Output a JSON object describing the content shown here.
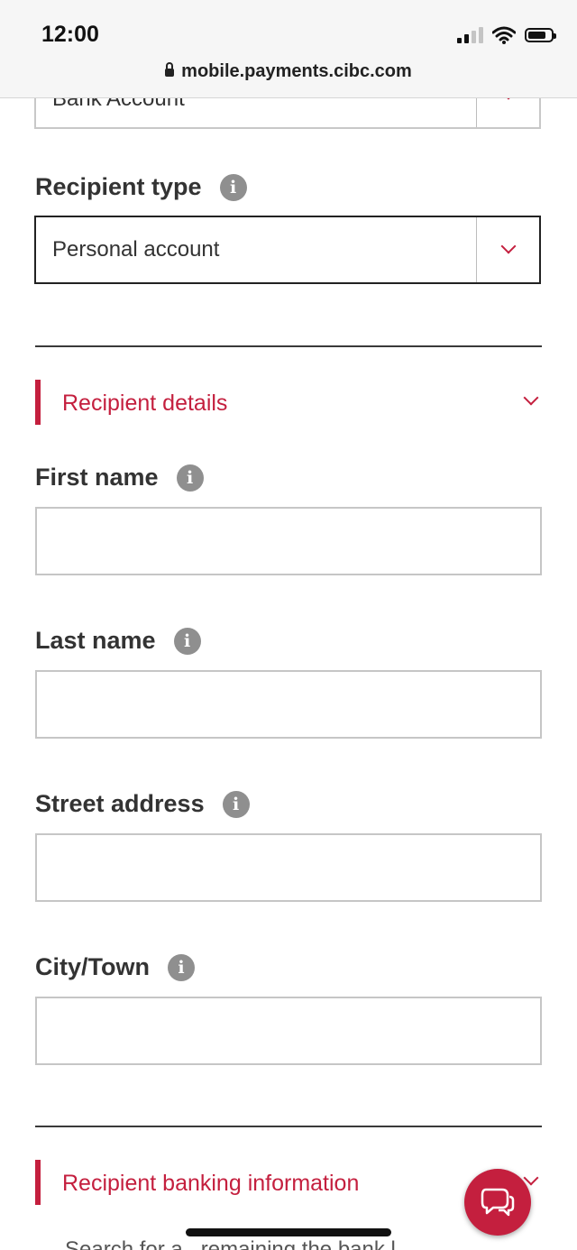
{
  "status_bar": {
    "time": "12:00"
  },
  "browser": {
    "url": "mobile.payments.cibc.com"
  },
  "form": {
    "prev_select": {
      "value": "Bank Account"
    },
    "recipient_type": {
      "label": "Recipient type",
      "value": "Personal account"
    },
    "sections": {
      "recipient_details": "Recipient details",
      "recipient_banking": "Recipient banking information"
    },
    "fields": {
      "first_name": {
        "label": "First name",
        "value": ""
      },
      "last_name": {
        "label": "Last name",
        "value": ""
      },
      "street_address": {
        "label": "Street address",
        "value": ""
      },
      "city_town": {
        "label": "City/Town",
        "value": ""
      }
    },
    "partial_bottom_text": "Search for a...remaining the bank l..."
  },
  "colors": {
    "accent": "#c41f3e",
    "info_icon": "#8f8f8f"
  },
  "icons": [
    "lock-icon",
    "signal-icon",
    "wifi-icon",
    "battery-icon",
    "info-icon",
    "chevron-down-icon",
    "chat-icon"
  ]
}
